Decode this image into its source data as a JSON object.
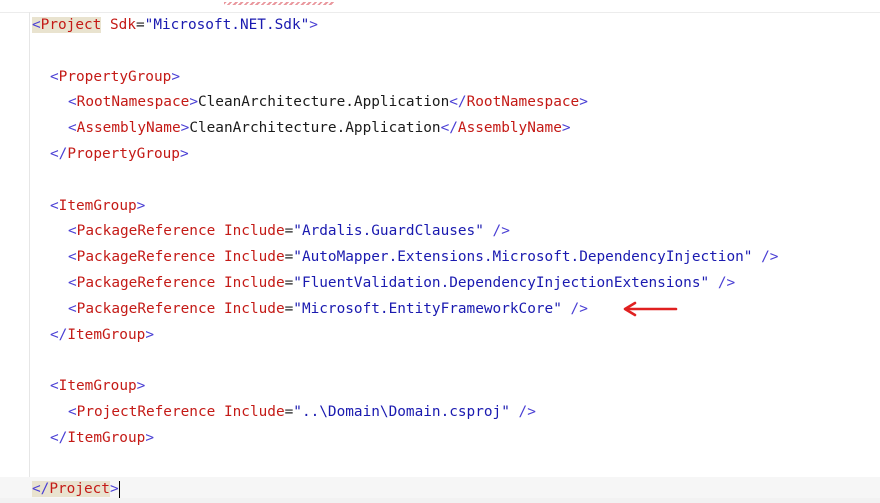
{
  "editor": {
    "lines": [
      {
        "open": "<",
        "name": "Project",
        "attr": " Sdk",
        "eq": "=",
        "value": "\"Microsoft.NET.Sdk\"",
        "close": ">"
      },
      {},
      {
        "open": "<",
        "name": "PropertyGroup",
        "close": ">"
      },
      {
        "open": "<",
        "name": "RootNamespace",
        "close": ">",
        "text": "CleanArchitecture.Application",
        "end_open": "</",
        "end_name": "RootNamespace",
        "end_close": ">"
      },
      {
        "open": "<",
        "name": "AssemblyName",
        "close": ">",
        "text": "CleanArchitecture.Application",
        "end_open": "</",
        "end_name": "AssemblyName",
        "end_close": ">"
      },
      {
        "open": "</",
        "name": "PropertyGroup",
        "close": ">"
      },
      {},
      {
        "open": "<",
        "name": "ItemGroup",
        "close": ">"
      },
      {
        "open": "<",
        "name": "PackageReference",
        "attr": " Include",
        "eq": "=",
        "value": "\"Ardalis.GuardClauses\"",
        "close": " />"
      },
      {
        "open": "<",
        "name": "PackageReference",
        "attr": " Include",
        "eq": "=",
        "value": "\"AutoMapper.Extensions.Microsoft.DependencyInjection\"",
        "close": " />"
      },
      {
        "open": "<",
        "name": "PackageReference",
        "attr": " Include",
        "eq": "=",
        "value": "\"FluentValidation.DependencyInjectionExtensions\"",
        "close": " />"
      },
      {
        "open": "<",
        "name": "PackageReference",
        "attr": " Include",
        "eq": "=",
        "value": "\"Microsoft.EntityFrameworkCore\"",
        "close": " />"
      },
      {
        "open": "</",
        "name": "ItemGroup",
        "close": ">"
      },
      {},
      {
        "open": "<",
        "name": "ItemGroup",
        "close": ">"
      },
      {
        "open": "<",
        "name": "ProjectReference",
        "attr": " Include",
        "eq": "=",
        "value": "\"..\\Domain\\Domain.csproj\"",
        "close": " />"
      },
      {
        "open": "</",
        "name": "ItemGroup",
        "close": ">"
      },
      {},
      {
        "open": "</",
        "name": "Project",
        "close": ">"
      }
    ]
  },
  "annotation": {
    "icon": "arrow-left-icon",
    "color": "#e02020"
  }
}
